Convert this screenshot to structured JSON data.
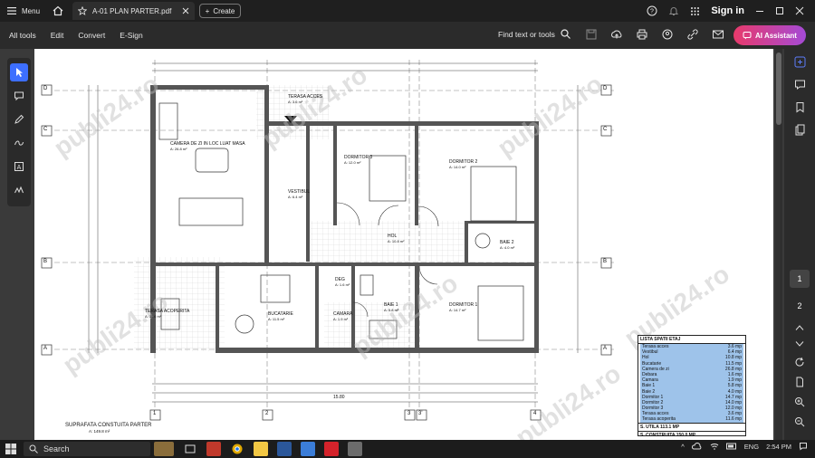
{
  "titlebar": {
    "menu_label": "Menu",
    "tab_title": "A-01 PLAN PARTER.pdf",
    "create_label": "Create",
    "sign_in": "Sign in"
  },
  "toolbar": {
    "items": [
      "All tools",
      "Edit",
      "Convert",
      "E-Sign"
    ],
    "find_label": "Find text or tools",
    "ai_label": "AI Assistant"
  },
  "plan": {
    "rooms": [
      {
        "name": "TERASA ACCES",
        "area": "A: 3.6 m²"
      },
      {
        "name": "CAMERA DE ZI IN LOC LUAT MASA",
        "area": "A: 26.8 m²"
      },
      {
        "name": "DORMITOR 3",
        "area": "A: 12.0 m²"
      },
      {
        "name": "DORMITOR 2",
        "area": "A: 14.0 m²"
      },
      {
        "name": "VESTIBUL",
        "area": "A: 6.4 m²"
      },
      {
        "name": "HOL",
        "area": "A: 10.8 m²"
      },
      {
        "name": "BAIE 2",
        "area": "A: 4.0 m²"
      },
      {
        "name": "TERASA ACOPERITA",
        "area": "A: 11.6 m²"
      },
      {
        "name": "BUCATARIE",
        "area": "A: 11.5 m²"
      },
      {
        "name": "CAMARA",
        "area": "A: 1.9 m²"
      },
      {
        "name": "BAIE 1",
        "area": "A: 5.8 m²"
      },
      {
        "name": "DORMITOR 1",
        "area": "A: 14.7 m²"
      },
      {
        "name": "DEG",
        "area": "A: 1.6 m²"
      }
    ],
    "axes_letters": [
      "D",
      "C",
      "B",
      "A"
    ],
    "axes_numbers": [
      "1",
      "2",
      "3",
      "3'",
      "4"
    ],
    "surface_title": "SUPRAFATA CONSTUITA PARTER",
    "surface_value": "A: 149.8 m²",
    "dimension_total": "15.80",
    "legend": {
      "title": "LISTA SPATII ETAJ",
      "rows": [
        {
          "name": "Terasa acces",
          "value": "3.6 mp"
        },
        {
          "name": "Vestibul",
          "value": "6.4 mp"
        },
        {
          "name": "Hol",
          "value": "10.8 mp"
        },
        {
          "name": "Bucatarie",
          "value": "11.5 mp"
        },
        {
          "name": "Camera de zi",
          "value": "26.8 mp"
        },
        {
          "name": "Debara",
          "value": "1.6 mp"
        },
        {
          "name": "Camara",
          "value": "1.9 mp"
        },
        {
          "name": "Baie 1",
          "value": "5.8 mp"
        },
        {
          "name": "Baie 2",
          "value": "4.0 mp"
        },
        {
          "name": "Dormitor 1",
          "value": "14.7 mp"
        },
        {
          "name": "Dormitor 2",
          "value": "14.0 mp"
        },
        {
          "name": "Dormitor 3",
          "value": "12.0 mp"
        },
        {
          "name": "Terasa acces",
          "value": "3.6 mp"
        },
        {
          "name": "Terasa acoperita",
          "value": "11.6 mp"
        }
      ],
      "util": "S. UTILA   113.1 MP",
      "construita": "S. CONSTRUITA   150.0 MP"
    }
  },
  "watermark": "publi24.ro",
  "right_rail": {
    "page_numbers": [
      "1",
      "2"
    ]
  },
  "taskbar": {
    "search_label": "Search",
    "language": "ENG",
    "time": "2:54 PM"
  }
}
